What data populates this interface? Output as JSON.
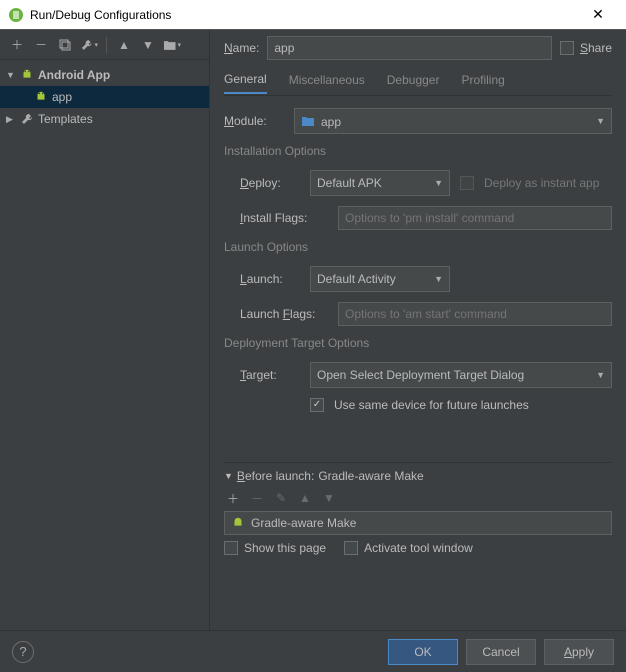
{
  "titlebar": {
    "title": "Run/Debug Configurations"
  },
  "sidebar": {
    "nodes": [
      {
        "label": "Android App",
        "kind": "folder"
      },
      {
        "label": "app",
        "kind": "config"
      },
      {
        "label": "Templates",
        "kind": "templates"
      }
    ]
  },
  "name": {
    "label": "Name:",
    "value": "app"
  },
  "share": {
    "label": "Share"
  },
  "tabs": [
    "General",
    "Miscellaneous",
    "Debugger",
    "Profiling"
  ],
  "general": {
    "module": {
      "label": "Module:",
      "value": "app"
    },
    "install_section": "Installation Options",
    "deploy": {
      "label": "Deploy:",
      "value": "Default APK"
    },
    "instant": {
      "label": "Deploy as instant app"
    },
    "install_flags": {
      "label": "Install Flags:",
      "placeholder": "Options to 'pm install' command"
    },
    "launch_section": "Launch Options",
    "launch": {
      "label": "Launch:",
      "value": "Default Activity"
    },
    "launch_flags": {
      "label": "Launch Flags:",
      "placeholder": "Options to 'am start' command"
    },
    "target_section": "Deployment Target Options",
    "target": {
      "label": "Target:",
      "value": "Open Select Deployment Target Dialog"
    },
    "same_device": {
      "label": "Use same device for future launches"
    }
  },
  "before_launch": {
    "header_prefix": "Before launch:",
    "header_value": "Gradle-aware Make",
    "item": "Gradle-aware Make",
    "show_page": "Show this page",
    "activate_window": "Activate tool window"
  },
  "buttons": {
    "ok": "OK",
    "cancel": "Cancel",
    "apply": "Apply"
  }
}
